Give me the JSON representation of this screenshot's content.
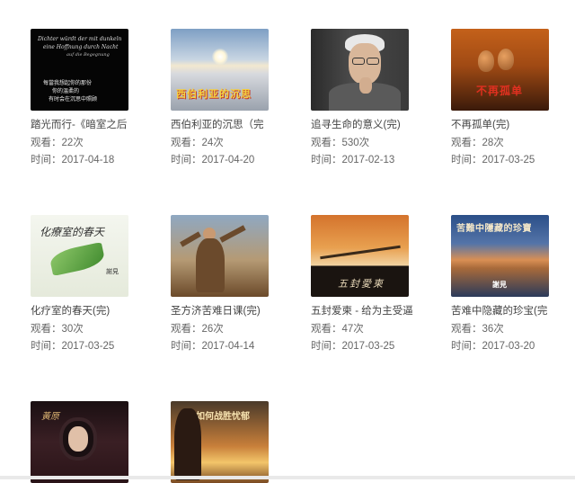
{
  "items": [
    {
      "title": "踏光而行-《暗室之后",
      "views": "观看：22次",
      "time": "时间：2017-04-18",
      "thumb": {
        "lines": [
          "Dichter würdt der mit dunkeln",
          "eine Hoffnung durch Nacht",
          "auf die Begegnung",
          "每當我想起你的那份",
          "你的温柔的",
          "有时会在沉思中照顾"
        ]
      }
    },
    {
      "title": "西伯利亚的沉思（完",
      "views": "观看：24次",
      "time": "时间：2017-04-20",
      "thumb": {
        "text": "西伯利亚的沉思"
      }
    },
    {
      "title": "追寻生命的意义(完)",
      "views": "观看：530次",
      "time": "时间：2017-02-13",
      "thumb": {}
    },
    {
      "title": "不再孤单(完)",
      "views": "观看：28次",
      "time": "时间：2017-03-25",
      "thumb": {
        "text": "不再孤单"
      }
    },
    {
      "title": "化疗室的春天(完)",
      "views": "观看：30次",
      "time": "时间：2017-03-25",
      "thumb": {
        "text": "化療室的春天",
        "small": "謝見"
      }
    },
    {
      "title": "圣方济苦难日课(完)",
      "views": "观看：26次",
      "time": "时间：2017-04-14",
      "thumb": {}
    },
    {
      "title": "五封爱柬 - 给为主受逼",
      "views": "观看：47次",
      "time": "时间：2017-03-25",
      "thumb": {
        "text": "五封愛柬"
      }
    },
    {
      "title": "苦难中隐藏的珍宝(完",
      "views": "观看：36次",
      "time": "时间：2017-03-20",
      "thumb": {
        "text": "苦難中隱藏的珍寶",
        "small": "謝見"
      }
    },
    {
      "title": "",
      "views": "",
      "time": "",
      "thumb": {
        "text": "黃原"
      }
    },
    {
      "title": "",
      "views": "",
      "time": "",
      "thumb": {
        "text": "如何战胜忧郁"
      }
    }
  ]
}
